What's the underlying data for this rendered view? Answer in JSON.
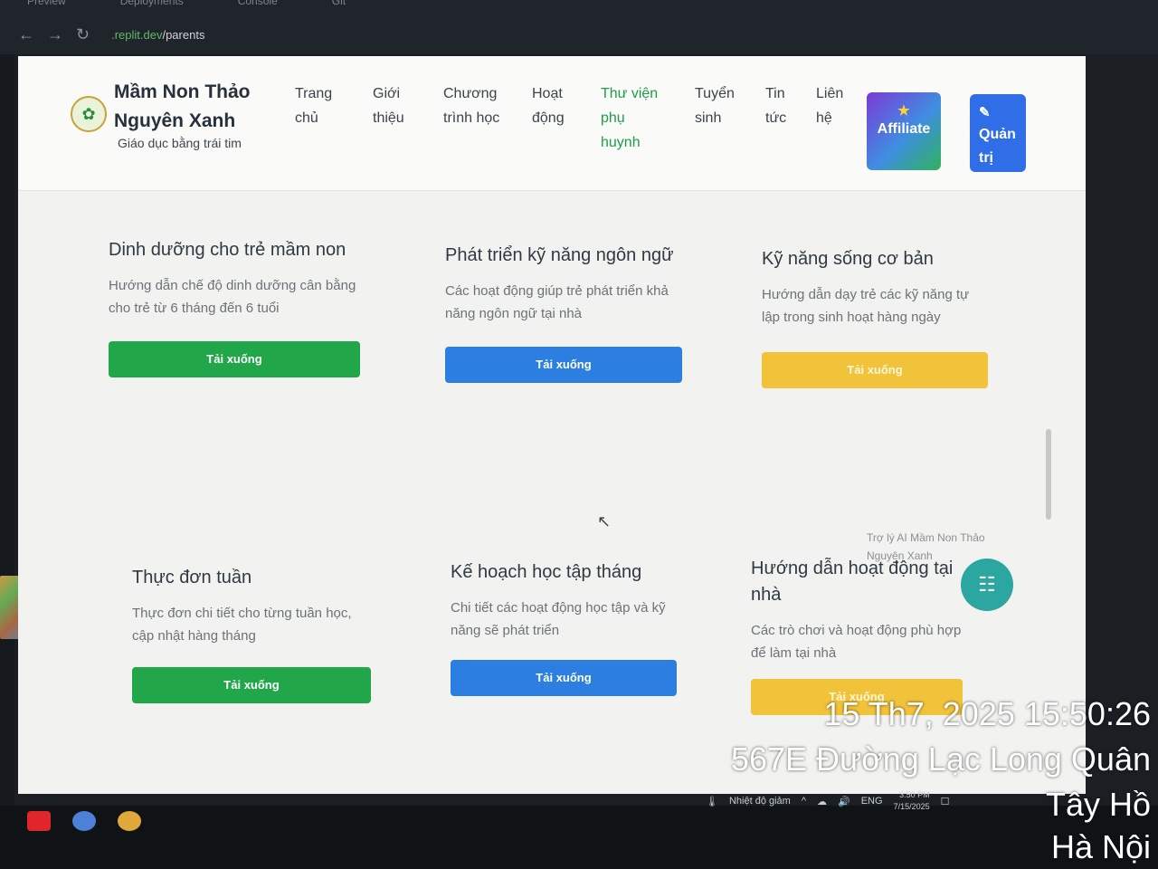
{
  "ide": {
    "tabs": [
      "Preview",
      "Deployments",
      "Console",
      "Git"
    ],
    "url_host": ".replit.dev",
    "url_path": "/parents"
  },
  "site": {
    "brand_title": "Mầm Non Thảo Nguyên Xanh",
    "brand_subtitle": "Giáo dục bằng trái tim",
    "menu": [
      {
        "label": "Trang chủ"
      },
      {
        "label": "Giới thiệu"
      },
      {
        "label": "Chương trình học"
      },
      {
        "label": "Hoạt động"
      },
      {
        "label": "Thư viện phụ huynh"
      },
      {
        "label": "Tuyển sinh"
      },
      {
        "label": "Tin tức"
      },
      {
        "label": "Liên hệ"
      }
    ],
    "affiliate_label": "Affiliate",
    "admin_label": "Quản trị"
  },
  "cards": [
    {
      "title": "Dinh dưỡng cho trẻ mầm non",
      "desc": "Hướng dẫn chế độ dinh dưỡng cân bằng cho trẻ từ 6 tháng đến 6 tuổi",
      "button": "Tải xuống",
      "color": "#21a64a"
    },
    {
      "title": "Phát triển kỹ năng ngôn ngữ",
      "desc": "Các hoạt động giúp trẻ phát triển khả năng ngôn ngữ tại nhà",
      "button": "Tải xuống",
      "color": "#2c7fe0"
    },
    {
      "title": "Kỹ năng sống cơ bản",
      "desc": "Hướng dẫn dạy trẻ các kỹ năng tự lập trong sinh hoạt hàng ngày",
      "button": "Tải xuống",
      "color": "#f1c33b"
    },
    {
      "title": "Thực đơn tuần",
      "desc": "Thực đơn chi tiết cho từng tuần học, cập nhật hàng tháng",
      "button": "Tải xuống",
      "color": "#21a64a"
    },
    {
      "title": "Kế hoạch học tập tháng",
      "desc": "Chi tiết các hoạt động học tập và kỹ năng sẽ phát triển",
      "button": "Tải xuống",
      "color": "#2c7fe0"
    },
    {
      "title": "Hướng dẫn hoạt động tại nhà",
      "desc": "Các trò chơi và hoạt động phù hợp để làm tại nhà",
      "button": "Tải xuống",
      "color": "#f1c33b"
    }
  ],
  "chat": {
    "label": "Trợ lý AI Mầm Non Thảo Nguyên Xanh"
  },
  "taskbar": {
    "weather": "Nhiệt độ giảm",
    "lang": "ENG",
    "time": "3:50 PM",
    "date": "7/15/2025"
  },
  "photo_stamp": {
    "datetime": "15 Th7, 2025 15:50:26",
    "line2": "567E Đường Lạc Long Quân",
    "line3": "Tây Hồ",
    "line4": "Hà Nội"
  }
}
